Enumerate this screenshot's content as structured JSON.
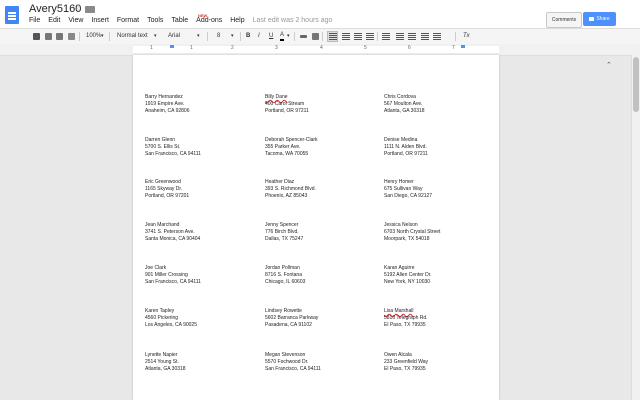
{
  "doc": {
    "title": "Avery5160",
    "last_edit": "Last edit was 2 hours ago"
  },
  "menu": [
    "File",
    "Edit",
    "View",
    "Insert",
    "Format",
    "Tools",
    "Table",
    "Add-ons",
    "Help"
  ],
  "new_badge": "NEW",
  "buttons": {
    "comments": "Comments",
    "share": "Share"
  },
  "toolbar": {
    "zoom": "100%",
    "style": "Normal text",
    "font": "Arial",
    "size": "8",
    "bold": "B",
    "italic": "I",
    "underline": "U",
    "color": "A",
    "collapse": "⌃",
    "clear_format": "Tx"
  },
  "ruler": [
    "1",
    "1",
    "2",
    "3",
    "4",
    "5",
    "6",
    "7"
  ],
  "labels": [
    {
      "name": "Barry Hernandez",
      "street": "1919 Empire Ave.",
      "city": "Anaheim, CA 92806"
    },
    {
      "name": "Billy Dane",
      "street": "400 Carol Stream",
      "city": "Portland, OR 97211"
    },
    {
      "name": "Chris Cordova",
      "street": "567 Moulton Ave.",
      "city": "Atlanta, GA 30318"
    },
    {
      "name": "Darren Glenn",
      "street": "5700 S. Ellis St.",
      "city": "San Francisco, CA 94111"
    },
    {
      "name": "Deborah Spencer-Clark",
      "street": "355 Parker Ave.",
      "city": "Tacoma, WA 70055"
    },
    {
      "name": "Denise Medina",
      "street": "1111 N. Alden Blvd.",
      "city": "Portland, OR 97211"
    },
    {
      "name": "Eric Greenwood",
      "street": "1165 Skyway Dr.",
      "city": "Portland, OR 97201"
    },
    {
      "name": "Heather Diaz",
      "street": "393 S. Richmond Blvd.",
      "city": "Phoenix, AZ 85043"
    },
    {
      "name": "Henry Homer",
      "street": "675 Sullivan Way",
      "city": "San Diego, CA 92127"
    },
    {
      "name": "Jean Marchand",
      "street": "3741 S. Peterson Ave.",
      "city": "Santa Monica, CA 90404"
    },
    {
      "name": "Jenny Spencer",
      "street": "776 Birch Blvd.",
      "city": "Dallas, TX 75247"
    },
    {
      "name": "Jessica Nelson",
      "street": "6703 North Crystal Street",
      "city": "Moorpark, TX 54018"
    },
    {
      "name": "Joe Clark",
      "street": "901 Miller Crossing",
      "city": "San Francisco, CA 94111"
    },
    {
      "name": "Jordan Pollman",
      "street": "8716 S. Fontana",
      "city": "Chicago, IL 60603"
    },
    {
      "name": "Karan Aguirre",
      "street": "5192 Allen Center Dr.",
      "city": "New York, NY 10030"
    },
    {
      "name": "Karen Tapley",
      "street": "4560 Pickering",
      "city": "Los Angeles, CA 90025"
    },
    {
      "name": "Lindsey Rowette",
      "street": "5602 Barranca Parkway",
      "city": "Pasadena, CA 91102"
    },
    {
      "name": "Lisa Marshall",
      "street": "5810 Telegraph Rd.",
      "city": "El Paso, TX 79935"
    },
    {
      "name": "Lynette Napier",
      "street": "2514 Young St.",
      "city": "Atlanta, GA 30318"
    },
    {
      "name": "Megan Stevenson",
      "street": "5570 Fochwood Dr.",
      "city": "San Francisco, CA 94111"
    },
    {
      "name": "Owen Alcala",
      "street": "233 Greenfield Way",
      "city": "El Paso, TX 79935"
    }
  ]
}
